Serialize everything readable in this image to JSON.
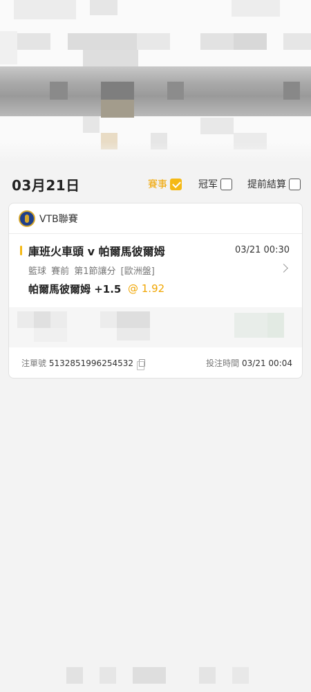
{
  "filter_bar": {
    "date": "03月21日",
    "filters": [
      {
        "label": "賽事",
        "checked": true
      },
      {
        "label": "冠军",
        "checked": false
      },
      {
        "label": "提前結算",
        "checked": false
      }
    ]
  },
  "bet": {
    "league": "VTB聯賽",
    "match_title": "庫班火車頭 v 帕爾馬彼爾姆",
    "match_time": "03/21 00:30",
    "meta": "籃球  賽前  第1節讓分  [歐洲盤]",
    "selection": "帕爾馬彼爾姆 +1.5",
    "odds": "@ 1.92",
    "order_label": "注單號",
    "order_number": "5132851996254532",
    "bet_time_label": "投注時間",
    "bet_time": "03/21 00:04"
  },
  "colors": {
    "accent": "#f5b915",
    "background": "#f3f3f3"
  },
  "icons": {
    "league": "vtb-league-logo-icon",
    "check": "checkbox-icon",
    "chevron": "chevron-right-icon",
    "copy": "copy-icon"
  }
}
